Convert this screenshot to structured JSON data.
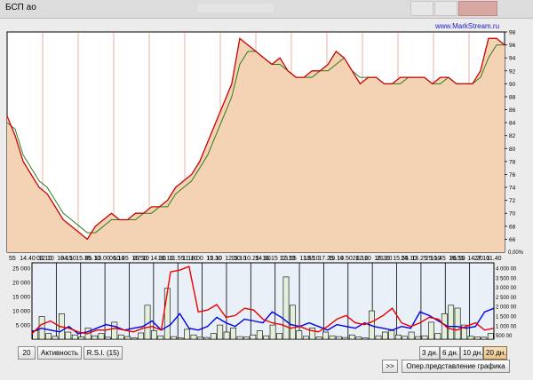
{
  "window": {
    "title": "БСП ао"
  },
  "watermark": "www.MarkStream.ru",
  "colors": {
    "plot_bg": "#ffffff",
    "area_fill": "#f3d3b3",
    "price_line": "#cc0000",
    "ma_line": "#2f7a1f",
    "volume_bg": "#e9f0f7",
    "blue_series": "#0000ee",
    "red_series": "#ee0000"
  },
  "chart_data": [
    {
      "type": "area",
      "ylim": [
        64,
        98
      ],
      "y_ticks": [
        66,
        68,
        70,
        72,
        74,
        76,
        78,
        80,
        82,
        84,
        86,
        88,
        90,
        92,
        94,
        96,
        98
      ],
      "x_tick_labels": [
        "55",
        "14.40",
        "12.10",
        "18.15",
        "15.35",
        "13.00",
        "10.45",
        "16.50",
        "14.30",
        "11.55",
        "18.00",
        "15.30",
        "12.50",
        "10.25",
        "16.15",
        "13.55",
        "11.55",
        "17.25",
        "14.50",
        "12.10",
        "18.35",
        "15.55",
        "13.25",
        "10.45",
        "16.55",
        "14.20",
        "11.40"
      ],
      "series": [
        {
          "name": "",
          "values": [
            85,
            82,
            78,
            76,
            74,
            73,
            71,
            69,
            68,
            67,
            66,
            68,
            69,
            70,
            69,
            69,
            70,
            70,
            71,
            71,
            72,
            74,
            75,
            76,
            78,
            81,
            84,
            87,
            90,
            97,
            96,
            95,
            94,
            93,
            94,
            92,
            91,
            91,
            92,
            92,
            93,
            95,
            94,
            92,
            90,
            91,
            91,
            90,
            90,
            91,
            91,
            91,
            91,
            90,
            91,
            91,
            90,
            90,
            90,
            92,
            97,
            97,
            96
          ]
        },
        {
          "name": "",
          "values": [
            84,
            83,
            79,
            77,
            75,
            74,
            72,
            70,
            69,
            68,
            67,
            67,
            68,
            69,
            69,
            69,
            69,
            70,
            70,
            71,
            71,
            73,
            74,
            75,
            77,
            79,
            82,
            85,
            88,
            93,
            95,
            95,
            94,
            93,
            93,
            92,
            91,
            91,
            91,
            92,
            92,
            93,
            94,
            92,
            91,
            91,
            91,
            90,
            90,
            90,
            91,
            91,
            91,
            90,
            90,
            91,
            90,
            90,
            90,
            91,
            94,
            96,
            96
          ]
        }
      ]
    },
    {
      "type": "bar",
      "date_labels": [
        "03.10",
        "04.10",
        "05.10",
        "06.10",
        "07.10",
        "10.10",
        "11.10",
        "12.10",
        "13.10",
        "14.10",
        "17.10",
        "18.10",
        "19.10",
        "20.10",
        "21.10",
        "24.10",
        "25.10",
        "26.10",
        "27.10"
      ],
      "left_ticks": [
        "25 000",
        "20 000",
        "15 000",
        "10 000",
        "5 000"
      ],
      "right_ticks": [
        "4 000 00",
        "3 500 00",
        "3 000 00",
        "2 500 00",
        "2 000 00",
        "1 500 00",
        "1 000 00",
        "500 00"
      ],
      "percent_label": "0,00%",
      "ylim_left": [
        0,
        27000
      ],
      "ylim_right": [
        0,
        4200000
      ],
      "volumes": [
        3000,
        8000,
        2000,
        1000,
        9000,
        2500,
        1500,
        800,
        4000,
        1200,
        2000,
        700,
        6000,
        1500,
        900,
        400,
        2200,
        12000,
        3000,
        1200,
        18000,
        900,
        400,
        3500,
        1500,
        700,
        600,
        2000,
        5000,
        2500,
        4000,
        900,
        800,
        1500,
        3000,
        1200,
        5000,
        2000,
        22000,
        12000,
        3000,
        1000,
        4000,
        800,
        2500,
        1200,
        900,
        600,
        1500,
        800,
        400,
        10000,
        1200,
        2500,
        3000,
        1500,
        1000,
        2500,
        900,
        1200,
        6000,
        2000,
        9000,
        12000,
        11000,
        5000,
        1000,
        800,
        700,
        2000
      ],
      "series": [
        {
          "name": "",
          "values": [
            400000,
            600000,
            500000,
            400000,
            700000,
            300000,
            400000,
            600000,
            800000,
            700000,
            500000,
            600000,
            700000,
            1000000,
            500000,
            800000,
            1400000,
            600000,
            500000,
            700000,
            1200000,
            900000,
            700000,
            1100000,
            1000000,
            900000,
            1500000,
            1200000,
            800000,
            700000,
            900000,
            700000,
            500000,
            800000,
            700000,
            600000,
            900000,
            700000,
            600000,
            500000,
            700000,
            600000,
            1500000,
            1300000,
            1000000,
            700000,
            700000,
            600000,
            700000,
            1500000,
            1700000
          ]
        },
        {
          "name": "",
          "values": [
            300000,
            800000,
            1000000,
            700000,
            600000,
            400000,
            300000,
            500000,
            500000,
            600000,
            500000,
            400000,
            600000,
            700000,
            500000,
            3700000,
            3800000,
            4000000,
            1500000,
            1600000,
            1900000,
            1200000,
            1300000,
            1700000,
            1600000,
            1100000,
            900000,
            800000,
            600000,
            700000,
            500000,
            400000,
            700000,
            1100000,
            1300000,
            900000,
            800000,
            1000000,
            1300000,
            1700000,
            900000,
            700000,
            900000,
            1200000,
            1100000,
            600000,
            500000,
            700000,
            900000,
            500000,
            600000
          ]
        }
      ]
    }
  ],
  "controls": {
    "period_value": "20",
    "activity_label": "Активность",
    "rsi_label": "R.S.I.  (15)",
    "next_label": ">>",
    "period_3": "3 дн.",
    "period_6": "6 дн.",
    "period_10": "10 дн.",
    "period_20": "20 дн.",
    "chart_view_label": "Опер.представление графика"
  }
}
